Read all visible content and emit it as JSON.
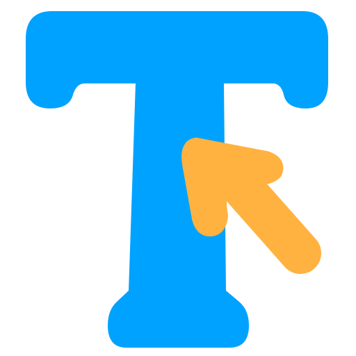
{
  "icon": {
    "name": "text-cursor-select-icon",
    "glyph_letter": "T",
    "colors": {
      "background": "#ffffff",
      "letter": "#00a2ff",
      "arrow": "#ffb23f"
    }
  }
}
